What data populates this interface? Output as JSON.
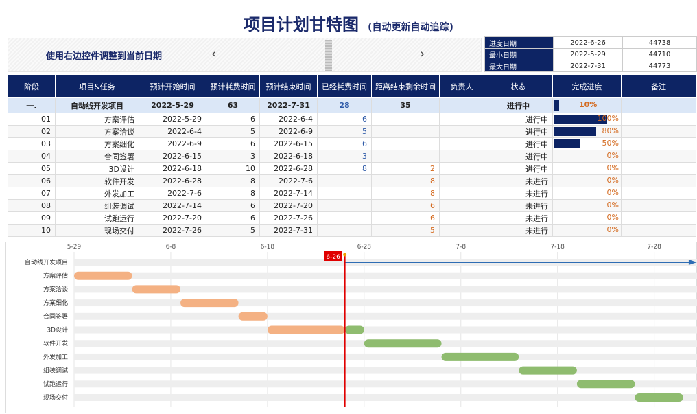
{
  "title": {
    "main": "项目计划甘特图",
    "sub": "(自动更新自动追踪)"
  },
  "control": {
    "label": "使用右边控件调整到当前日期",
    "left_arrow": "‹",
    "right_arrow": "›"
  },
  "info_rows": [
    {
      "label": "进度日期",
      "date": "2022-6-26",
      "serial": "44738"
    },
    {
      "label": "最小日期",
      "date": "2022-5-29",
      "serial": "44710"
    },
    {
      "label": "最大日期",
      "date": "2022-7-31",
      "serial": "44773"
    }
  ],
  "table": {
    "headers": [
      "阶段",
      "项目&任务",
      "预计开始时间",
      "预计耗费时间",
      "预计结束时间",
      "已经耗费时间",
      "距离结束剩余时间",
      "负责人",
      "状态",
      "完成进度",
      "备注"
    ],
    "summary": {
      "stage": "一.",
      "task": "自动线开发项目",
      "start": "2022-5-29",
      "duration": "63",
      "end": "2022-7-31",
      "elapsed": "28",
      "remaining": "35",
      "owner": "",
      "status": "进行中",
      "progress_text": "10%",
      "progress": 0.1,
      "note": ""
    },
    "rows": [
      {
        "stage": "01",
        "task": "方案评估",
        "start": "2022-5-29",
        "duration": "6",
        "end": "2022-6-4",
        "elapsed": "6",
        "remaining": "",
        "owner": "",
        "status": "进行中",
        "progress_text": "100%",
        "progress": 1.0,
        "note": ""
      },
      {
        "stage": "02",
        "task": "方案洽谈",
        "start": "2022-6-4",
        "duration": "5",
        "end": "2022-6-9",
        "elapsed": "5",
        "remaining": "",
        "owner": "",
        "status": "进行中",
        "progress_text": "80%",
        "progress": 0.8,
        "note": ""
      },
      {
        "stage": "03",
        "task": "方案细化",
        "start": "2022-6-9",
        "duration": "6",
        "end": "2022-6-15",
        "elapsed": "6",
        "remaining": "",
        "owner": "",
        "status": "进行中",
        "progress_text": "50%",
        "progress": 0.5,
        "note": ""
      },
      {
        "stage": "04",
        "task": "合同签署",
        "start": "2022-6-15",
        "duration": "3",
        "end": "2022-6-18",
        "elapsed": "3",
        "remaining": "",
        "owner": "",
        "status": "进行中",
        "progress_text": "0%",
        "progress": 0.0,
        "note": ""
      },
      {
        "stage": "05",
        "task": "3D设计",
        "start": "2022-6-18",
        "duration": "10",
        "end": "2022-6-28",
        "elapsed": "8",
        "remaining": "2",
        "owner": "",
        "status": "进行中",
        "progress_text": "0%",
        "progress": 0.0,
        "note": ""
      },
      {
        "stage": "06",
        "task": "软件开发",
        "start": "2022-6-28",
        "duration": "8",
        "end": "2022-7-6",
        "elapsed": "",
        "remaining": "8",
        "owner": "",
        "status": "未进行",
        "progress_text": "0%",
        "progress": 0.0,
        "note": ""
      },
      {
        "stage": "07",
        "task": "外发加工",
        "start": "2022-7-6",
        "duration": "8",
        "end": "2022-7-14",
        "elapsed": "",
        "remaining": "8",
        "owner": "",
        "status": "未进行",
        "progress_text": "0%",
        "progress": 0.0,
        "note": ""
      },
      {
        "stage": "08",
        "task": "组装调试",
        "start": "2022-7-14",
        "duration": "6",
        "end": "2022-7-20",
        "elapsed": "",
        "remaining": "6",
        "owner": "",
        "status": "未进行",
        "progress_text": "0%",
        "progress": 0.0,
        "note": ""
      },
      {
        "stage": "09",
        "task": "试跑运行",
        "start": "2022-7-20",
        "duration": "6",
        "end": "2022-7-26",
        "elapsed": "",
        "remaining": "6",
        "owner": "",
        "status": "未进行",
        "progress_text": "0%",
        "progress": 0.0,
        "note": ""
      },
      {
        "stage": "10",
        "task": "现场交付",
        "start": "2022-7-26",
        "duration": "5",
        "end": "2022-7-31",
        "elapsed": "",
        "remaining": "5",
        "owner": "",
        "status": "未进行",
        "progress_text": "0%",
        "progress": 0.0,
        "note": ""
      }
    ]
  },
  "chart_data": {
    "type": "bar",
    "ticks": [
      "5-29",
      "6-8",
      "6-18",
      "6-28",
      "7-8",
      "7-18",
      "7-28"
    ],
    "tick_values": [
      "2022-5-29",
      "2022-6-8",
      "2022-6-18",
      "2022-6-28",
      "2022-7-8",
      "2022-7-18",
      "2022-7-28"
    ],
    "xlim": [
      "2022-5-29",
      "2022-8-1"
    ],
    "today_label": "6-26",
    "today": "2022-6-26",
    "categories": [
      "自动线开发项目",
      "方案评估",
      "方案洽谈",
      "方案细化",
      "合同签署",
      "3D设计",
      "软件开发",
      "外发加工",
      "组装调试",
      "试跑运行",
      "现场交付"
    ],
    "tasks": [
      {
        "name": "自动线开发项目",
        "start": "2022-5-29",
        "end": "2022-7-31"
      },
      {
        "name": "方案评估",
        "start": "2022-5-29",
        "end": "2022-6-4"
      },
      {
        "name": "方案洽谈",
        "start": "2022-6-4",
        "end": "2022-6-9"
      },
      {
        "name": "方案细化",
        "start": "2022-6-9",
        "end": "2022-6-15"
      },
      {
        "name": "合同签署",
        "start": "2022-6-15",
        "end": "2022-6-18"
      },
      {
        "name": "3D设计",
        "start": "2022-6-18",
        "end": "2022-6-28"
      },
      {
        "name": "软件开发",
        "start": "2022-6-28",
        "end": "2022-7-6"
      },
      {
        "name": "外发加工",
        "start": "2022-7-6",
        "end": "2022-7-14"
      },
      {
        "name": "组装调试",
        "start": "2022-7-14",
        "end": "2022-7-20"
      },
      {
        "name": "试跑运行",
        "start": "2022-7-20",
        "end": "2022-7-26"
      },
      {
        "name": "现场交付",
        "start": "2022-7-26",
        "end": "2022-7-31"
      }
    ],
    "colors": {
      "done": "#f4b183",
      "future": "#8fbc6f",
      "today_line": "#e00000",
      "arrow": "#2e6db4",
      "background_bar": "#eeeeee"
    },
    "grid": true
  }
}
